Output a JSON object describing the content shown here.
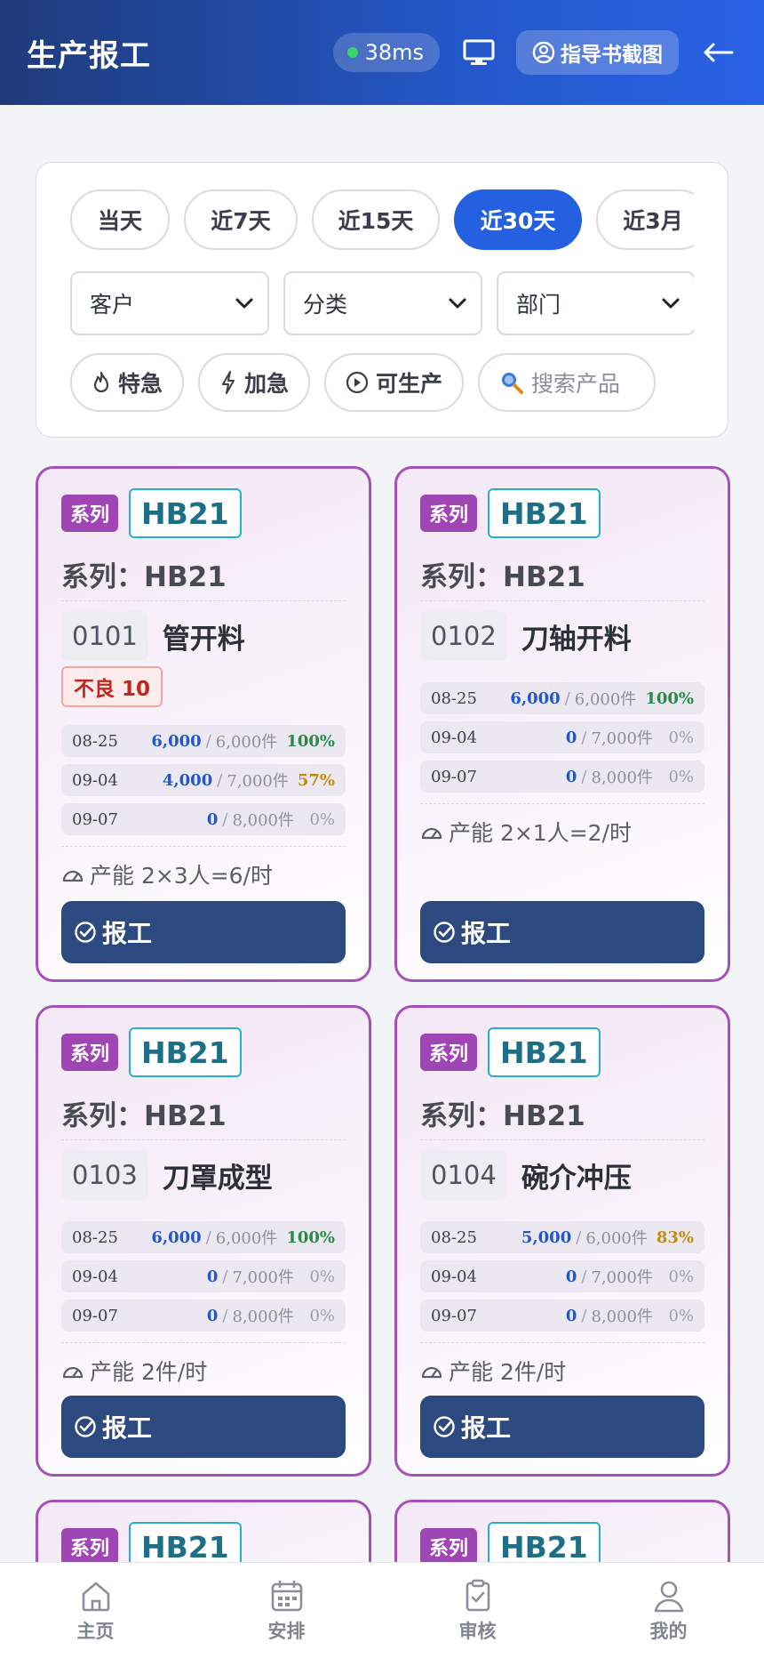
{
  "header": {
    "title": "生产报工",
    "latency": "38ms",
    "guide_label": "指导书截图",
    "icons": [
      "monitor-icon",
      "user-circle-icon",
      "back-arrow-icon"
    ]
  },
  "filters": {
    "date_ranges": [
      {
        "label": "当天",
        "active": false
      },
      {
        "label": "近7天",
        "active": false
      },
      {
        "label": "近15天",
        "active": false
      },
      {
        "label": "近30天",
        "active": true
      },
      {
        "label": "近3月",
        "active": false
      }
    ],
    "selects": [
      {
        "label": "客户"
      },
      {
        "label": "分类"
      },
      {
        "label": "部门"
      }
    ],
    "tags": [
      {
        "label": "特急",
        "icon": "flame-icon"
      },
      {
        "label": "加急",
        "icon": "lightning-icon"
      },
      {
        "label": "可生产",
        "icon": "play-circle-icon"
      }
    ],
    "search_placeholder": "搜索产品"
  },
  "cards": [
    {
      "series_tag": "系列",
      "code": "HB21",
      "series_line": "系列：HB21",
      "proc_code": "0101",
      "proc_name": "管开料",
      "bad": "不良 10",
      "schedule": [
        {
          "date": "08-25",
          "done": "6,000",
          "total": "6,000件",
          "pct": "100%",
          "level": "g"
        },
        {
          "date": "09-04",
          "done": "4,000",
          "total": "7,000件",
          "pct": "57%",
          "level": "y"
        },
        {
          "date": "09-07",
          "done": "0",
          "total": "8,000件",
          "pct": "0%",
          "level": "z"
        }
      ],
      "capacity": "产能 2×3人=6/时",
      "button": "报工"
    },
    {
      "series_tag": "系列",
      "code": "HB21",
      "series_line": "系列：HB21",
      "proc_code": "0102",
      "proc_name": "刀轴开料",
      "bad": "",
      "schedule": [
        {
          "date": "08-25",
          "done": "6,000",
          "total": "6,000件",
          "pct": "100%",
          "level": "g"
        },
        {
          "date": "09-04",
          "done": "0",
          "total": "7,000件",
          "pct": "0%",
          "level": "z"
        },
        {
          "date": "09-07",
          "done": "0",
          "total": "8,000件",
          "pct": "0%",
          "level": "z"
        }
      ],
      "capacity": "产能 2×1人=2/时",
      "button": "报工"
    },
    {
      "series_tag": "系列",
      "code": "HB21",
      "series_line": "系列：HB21",
      "proc_code": "0103",
      "proc_name": "刀罩成型",
      "bad": "",
      "schedule": [
        {
          "date": "08-25",
          "done": "6,000",
          "total": "6,000件",
          "pct": "100%",
          "level": "g"
        },
        {
          "date": "09-04",
          "done": "0",
          "total": "7,000件",
          "pct": "0%",
          "level": "z"
        },
        {
          "date": "09-07",
          "done": "0",
          "total": "8,000件",
          "pct": "0%",
          "level": "z"
        }
      ],
      "capacity": "产能 2件/时",
      "button": "报工"
    },
    {
      "series_tag": "系列",
      "code": "HB21",
      "series_line": "系列：HB21",
      "proc_code": "0104",
      "proc_name": "碗介冲压",
      "bad": "",
      "schedule": [
        {
          "date": "08-25",
          "done": "5,000",
          "total": "6,000件",
          "pct": "83%",
          "level": "y"
        },
        {
          "date": "09-04",
          "done": "0",
          "total": "7,000件",
          "pct": "0%",
          "level": "z"
        },
        {
          "date": "09-07",
          "done": "0",
          "total": "8,000件",
          "pct": "0%",
          "level": "z"
        }
      ],
      "capacity": "产能 2件/时",
      "button": "报工"
    },
    {
      "series_tag": "系列",
      "code": "HB21"
    },
    {
      "series_tag": "系列",
      "code": "HB21"
    }
  ],
  "bottom_nav": [
    {
      "label": "主页",
      "icon": "home-icon"
    },
    {
      "label": "安排",
      "icon": "calendar-icon"
    },
    {
      "label": "审核",
      "icon": "clipboard-check-icon"
    },
    {
      "label": "我的",
      "icon": "user-icon"
    }
  ],
  "colors": {
    "header_start": "#1f3b7a",
    "header_end": "#2a62e6",
    "accent": "#2460e0",
    "card_border": "#a452b8",
    "series_tag": "#a045b4",
    "code_border": "#25b0d2",
    "report_button": "#2d4a80",
    "done_blue": "#2457c8",
    "pct_green": "#2b8a4a",
    "pct_yellow": "#c48a12"
  }
}
